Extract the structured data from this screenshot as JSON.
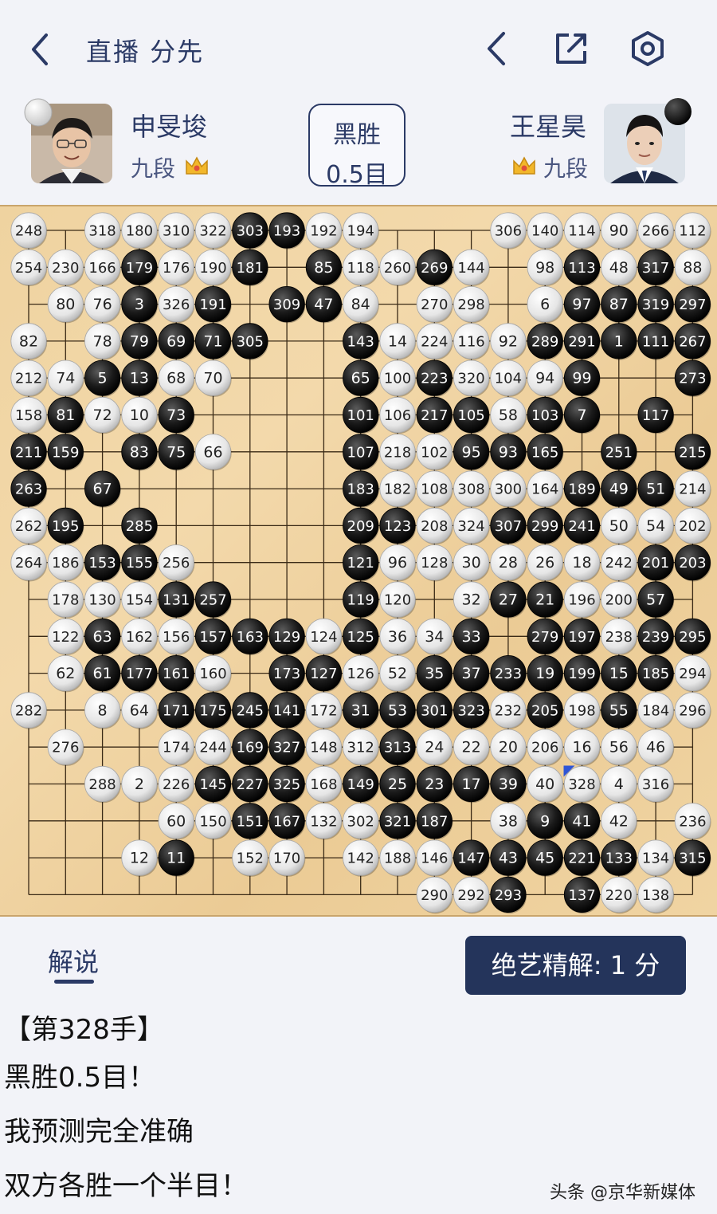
{
  "header": {
    "title": "直播 分先"
  },
  "players": {
    "left": {
      "name": "申旻埈",
      "rank": "九段",
      "stone": "white"
    },
    "right": {
      "name": "王星昊",
      "rank": "九段",
      "stone": "black"
    }
  },
  "result": {
    "line1": "黑胜",
    "line2": "0.5目"
  },
  "tabs": {
    "commentary": "解说"
  },
  "ai_button": {
    "label": "绝艺精解: 1 分"
  },
  "commentary": {
    "lines": [
      "【第328手】",
      "黑胜0.5目！",
      "我预测完全准确",
      "双方各胜一个半目！"
    ]
  },
  "watermark": "头条 @京华新媒体",
  "board": {
    "last_move": 328,
    "rows": [
      [
        [
          "w",
          248
        ],
        null,
        [
          "w",
          318
        ],
        [
          "w",
          180
        ],
        [
          "w",
          310
        ],
        [
          "w",
          322
        ],
        [
          "b",
          303
        ],
        [
          "b",
          193
        ],
        [
          "w",
          192
        ],
        [
          "w",
          194
        ],
        null,
        null,
        null,
        [
          "w",
          306
        ],
        [
          "w",
          140
        ],
        [
          "w",
          114
        ],
        [
          "w",
          90
        ],
        [
          "w",
          266
        ],
        [
          "w",
          112
        ]
      ],
      [
        [
          "w",
          254
        ],
        [
          "w",
          230
        ],
        [
          "w",
          166
        ],
        [
          "b",
          179
        ],
        [
          "w",
          176
        ],
        [
          "w",
          190
        ],
        [
          "b",
          181
        ],
        null,
        [
          "b",
          85
        ],
        [
          "w",
          118
        ],
        [
          "w",
          260
        ],
        [
          "b",
          269
        ],
        [
          "w",
          144
        ],
        null,
        [
          "w",
          98
        ],
        [
          "b",
          113
        ],
        [
          "w",
          48
        ],
        [
          "b",
          317
        ],
        [
          "w",
          88
        ]
      ],
      [
        null,
        [
          "w",
          80
        ],
        [
          "w",
          76
        ],
        [
          "b",
          3
        ],
        [
          "w",
          326
        ],
        [
          "b",
          191
        ],
        null,
        [
          "b",
          309
        ],
        [
          "b",
          47
        ],
        [
          "w",
          84
        ],
        null,
        [
          "w",
          270
        ],
        [
          "w",
          298
        ],
        null,
        [
          "w",
          6
        ],
        [
          "b",
          97
        ],
        [
          "b",
          87
        ],
        [
          "b",
          319
        ],
        [
          "b",
          297
        ]
      ],
      [
        [
          "w",
          82
        ],
        null,
        [
          "w",
          78
        ],
        [
          "b",
          79
        ],
        [
          "b",
          69
        ],
        [
          "b",
          71
        ],
        [
          "b",
          305
        ],
        null,
        null,
        [
          "b",
          143
        ],
        [
          "w",
          14
        ],
        [
          "w",
          224
        ],
        [
          "w",
          116
        ],
        [
          "w",
          92
        ],
        [
          "b",
          289
        ],
        [
          "b",
          291
        ],
        [
          "b",
          1
        ],
        [
          "b",
          111
        ],
        [
          "b",
          267
        ]
      ],
      [
        [
          "w",
          212
        ],
        [
          "w",
          74
        ],
        [
          "b",
          5
        ],
        [
          "b",
          13
        ],
        [
          "w",
          68
        ],
        [
          "w",
          70
        ],
        null,
        null,
        null,
        [
          "b",
          65
        ],
        [
          "w",
          100
        ],
        [
          "b",
          223
        ],
        [
          "w",
          320
        ],
        [
          "w",
          104
        ],
        [
          "w",
          94
        ],
        [
          "b",
          99
        ],
        null,
        null,
        [
          "b",
          273
        ]
      ],
      [
        [
          "w",
          158
        ],
        [
          "b",
          81
        ],
        [
          "w",
          72
        ],
        [
          "w",
          10
        ],
        [
          "b",
          73
        ],
        null,
        null,
        null,
        null,
        [
          "b",
          101
        ],
        [
          "w",
          106
        ],
        [
          "b",
          217
        ],
        [
          "b",
          105
        ],
        [
          "w",
          58
        ],
        [
          "b",
          103
        ],
        [
          "b",
          7
        ],
        null,
        [
          "b",
          117
        ],
        null
      ],
      [
        [
          "b",
          211
        ],
        [
          "b",
          159
        ],
        null,
        [
          "b",
          83
        ],
        [
          "b",
          75
        ],
        [
          "w",
          66
        ],
        null,
        null,
        null,
        [
          "b",
          107
        ],
        [
          "w",
          218
        ],
        [
          "w",
          102
        ],
        [
          "b",
          95
        ],
        [
          "b",
          93
        ],
        [
          "b",
          165
        ],
        null,
        [
          "b",
          251
        ],
        null,
        [
          "b",
          215
        ]
      ],
      [
        [
          "b",
          263
        ],
        null,
        [
          "b",
          67
        ],
        null,
        null,
        null,
        null,
        null,
        null,
        [
          "b",
          183
        ],
        [
          "w",
          182
        ],
        [
          "w",
          108
        ],
        [
          "w",
          308
        ],
        [
          "w",
          300
        ],
        [
          "w",
          164
        ],
        [
          "b",
          189
        ],
        [
          "b",
          49
        ],
        [
          "b",
          51
        ],
        [
          "w",
          214
        ]
      ],
      [
        [
          "w",
          262
        ],
        [
          "b",
          195
        ],
        null,
        [
          "b",
          285
        ],
        null,
        null,
        null,
        null,
        null,
        [
          "b",
          209
        ],
        [
          "b",
          123
        ],
        [
          "w",
          208
        ],
        [
          "w",
          324
        ],
        [
          "b",
          307
        ],
        [
          "b",
          299
        ],
        [
          "b",
          241
        ],
        [
          "w",
          50
        ],
        [
          "w",
          54
        ],
        [
          "w",
          202
        ]
      ],
      [
        [
          "w",
          264
        ],
        [
          "w",
          186
        ],
        [
          "b",
          153
        ],
        [
          "b",
          155
        ],
        [
          "w",
          256
        ],
        null,
        null,
        null,
        null,
        [
          "b",
          121
        ],
        [
          "w",
          96
        ],
        [
          "w",
          128
        ],
        [
          "w",
          30
        ],
        [
          "w",
          28
        ],
        [
          "w",
          26
        ],
        [
          "w",
          18
        ],
        [
          "w",
          242
        ],
        [
          "b",
          201
        ],
        [
          "b",
          203
        ]
      ],
      [
        null,
        [
          "w",
          178
        ],
        [
          "w",
          130
        ],
        [
          "w",
          154
        ],
        [
          "b",
          131
        ],
        [
          "b",
          257
        ],
        null,
        null,
        null,
        [
          "b",
          119
        ],
        [
          "w",
          120
        ],
        null,
        [
          "w",
          32
        ],
        [
          "b",
          27
        ],
        [
          "b",
          21
        ],
        [
          "w",
          196
        ],
        [
          "w",
          200
        ],
        [
          "b",
          57
        ],
        null
      ],
      [
        null,
        [
          "w",
          122
        ],
        [
          "b",
          63
        ],
        [
          "w",
          162
        ],
        [
          "w",
          156
        ],
        [
          "b",
          157
        ],
        [
          "b",
          163
        ],
        [
          "b",
          129
        ],
        [
          "w",
          124
        ],
        [
          "b",
          125
        ],
        [
          "w",
          36
        ],
        [
          "w",
          34
        ],
        [
          "b",
          33
        ],
        null,
        [
          "b",
          279
        ],
        [
          "b",
          197
        ],
        [
          "w",
          238
        ],
        [
          "b",
          239
        ],
        [
          "b",
          295
        ]
      ],
      [
        null,
        [
          "w",
          62
        ],
        [
          "b",
          61
        ],
        [
          "b",
          177
        ],
        [
          "b",
          161
        ],
        [
          "w",
          160
        ],
        null,
        [
          "b",
          173
        ],
        [
          "b",
          127
        ],
        [
          "w",
          126
        ],
        [
          "w",
          52
        ],
        [
          "b",
          35
        ],
        [
          "b",
          37
        ],
        [
          "b",
          233
        ],
        [
          "b",
          19
        ],
        [
          "b",
          199
        ],
        [
          "b",
          15
        ],
        [
          "b",
          185
        ],
        [
          "w",
          294
        ]
      ],
      [
        [
          "w",
          282
        ],
        null,
        [
          "w",
          8
        ],
        [
          "w",
          64
        ],
        [
          "b",
          171
        ],
        [
          "b",
          175
        ],
        [
          "b",
          245
        ],
        [
          "b",
          141
        ],
        [
          "w",
          172
        ],
        [
          "b",
          31
        ],
        [
          "b",
          53
        ],
        [
          "b",
          301
        ],
        [
          "b",
          323
        ],
        [
          "w",
          232
        ],
        [
          "b",
          205
        ],
        [
          "w",
          198
        ],
        [
          "b",
          55
        ],
        [
          "w",
          184
        ],
        [
          "w",
          296
        ]
      ],
      [
        null,
        [
          "w",
          276
        ],
        null,
        null,
        [
          "w",
          174
        ],
        [
          "w",
          244
        ],
        [
          "b",
          169
        ],
        [
          "b",
          327
        ],
        [
          "w",
          148
        ],
        [
          "w",
          312
        ],
        [
          "b",
          313
        ],
        [
          "w",
          24
        ],
        [
          "w",
          22
        ],
        [
          "w",
          20
        ],
        [
          "w",
          206
        ],
        [
          "w",
          16
        ],
        [
          "w",
          56
        ],
        [
          "w",
          46
        ],
        null
      ],
      [
        null,
        null,
        [
          "w",
          288
        ],
        [
          "w",
          2
        ],
        [
          "w",
          226
        ],
        [
          "b",
          145
        ],
        [
          "b",
          227
        ],
        [
          "b",
          325
        ],
        [
          "w",
          168
        ],
        [
          "b",
          149
        ],
        [
          "b",
          25
        ],
        [
          "b",
          23
        ],
        [
          "b",
          17
        ],
        [
          "b",
          39
        ],
        [
          "w",
          40
        ],
        [
          "w",
          328
        ],
        [
          "w",
          4
        ],
        [
          "w",
          316
        ],
        null
      ],
      [
        null,
        null,
        null,
        null,
        [
          "w",
          60
        ],
        [
          "w",
          150
        ],
        [
          "b",
          151
        ],
        [
          "b",
          167
        ],
        [
          "w",
          132
        ],
        [
          "w",
          302
        ],
        [
          "b",
          321
        ],
        [
          "b",
          187
        ],
        null,
        [
          "w",
          38
        ],
        [
          "b",
          9
        ],
        [
          "b",
          41
        ],
        [
          "w",
          42
        ],
        null,
        [
          "w",
          236
        ]
      ],
      [
        null,
        null,
        null,
        [
          "w",
          12
        ],
        [
          "b",
          11
        ],
        null,
        [
          "w",
          152
        ],
        [
          "w",
          170
        ],
        null,
        [
          "w",
          142
        ],
        [
          "w",
          188
        ],
        [
          "w",
          146
        ],
        [
          "b",
          147
        ],
        [
          "b",
          43
        ],
        [
          "b",
          45
        ],
        [
          "b",
          221
        ],
        [
          "b",
          133
        ],
        [
          "w",
          134
        ],
        [
          "b",
          315
        ]
      ],
      [
        null,
        null,
        null,
        null,
        null,
        null,
        null,
        null,
        null,
        null,
        null,
        [
          "w",
          290
        ],
        [
          "w",
          292
        ],
        [
          "b",
          293
        ],
        null,
        [
          "b",
          137
        ],
        [
          "w",
          220
        ],
        [
          "w",
          138
        ],
        null
      ]
    ]
  }
}
